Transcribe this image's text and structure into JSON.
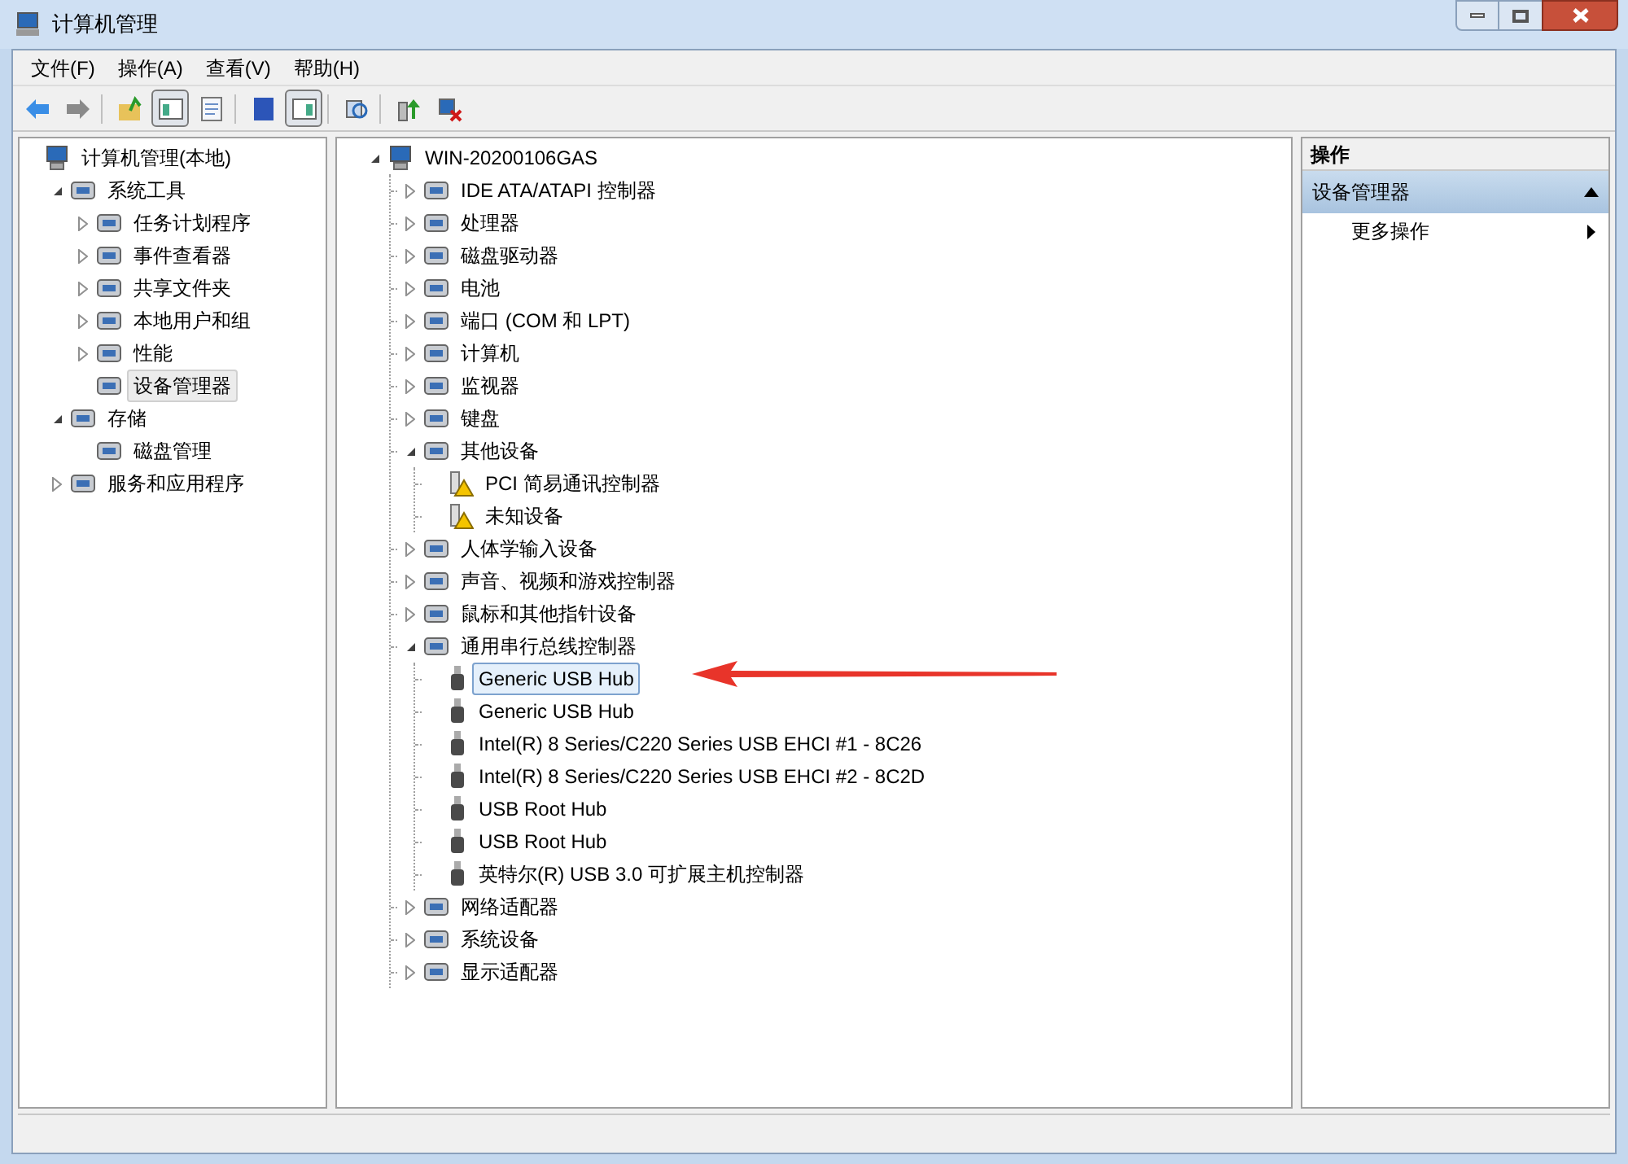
{
  "window": {
    "title": "计算机管理"
  },
  "menu": [
    "文件(F)",
    "操作(A)",
    "查看(V)",
    "帮助(H)"
  ],
  "toolbar": [
    {
      "pressed": false
    },
    {
      "pressed": false
    },
    {
      "pressed": false
    },
    {
      "pressed": true
    },
    {
      "pressed": false
    },
    {
      "pressed": false
    },
    {
      "pressed": true
    },
    {
      "pressed": false
    },
    {
      "pressed": false
    },
    {
      "pressed": false
    }
  ],
  "nav_tree": [
    {
      "label": "计算机管理(本地)",
      "selected": false,
      "children": [
        {
          "label": "系统工具",
          "expanded": true,
          "selected": false,
          "children": [
            {
              "label": "任务计划程序",
              "expanded": false,
              "selected": false
            },
            {
              "label": "事件查看器",
              "expanded": false,
              "selected": false
            },
            {
              "label": "共享文件夹",
              "expanded": false,
              "selected": false
            },
            {
              "label": "本地用户和组",
              "expanded": false,
              "selected": false
            },
            {
              "label": "性能",
              "expanded": false,
              "selected": false
            },
            {
              "label": "设备管理器",
              "selected": true
            }
          ]
        },
        {
          "label": "存储",
          "expanded": true,
          "selected": false,
          "children": [
            {
              "label": "磁盘管理",
              "selected": false
            }
          ]
        },
        {
          "label": "服务和应用程序",
          "expanded": false,
          "selected": false
        }
      ]
    }
  ],
  "device_tree": [
    {
      "label": "WIN-20200106GAS",
      "expanded": true,
      "selected": false,
      "children": [
        {
          "label": "IDE ATA/ATAPI 控制器",
          "expanded": false,
          "selected": false
        },
        {
          "label": "处理器",
          "expanded": false,
          "selected": false
        },
        {
          "label": "磁盘驱动器",
          "expanded": false,
          "selected": false
        },
        {
          "label": "电池",
          "expanded": false,
          "selected": false
        },
        {
          "label": "端口 (COM 和 LPT)",
          "expanded": false,
          "selected": false
        },
        {
          "label": "计算机",
          "expanded": false,
          "selected": false
        },
        {
          "label": "监视器",
          "expanded": false,
          "selected": false
        },
        {
          "label": "键盘",
          "expanded": false,
          "selected": false
        },
        {
          "label": "其他设备",
          "expanded": true,
          "selected": false,
          "children": [
            {
              "label": "PCI 简易通讯控制器",
              "selected": false,
              "warning": true
            },
            {
              "label": "未知设备",
              "selected": false,
              "warning": true
            }
          ]
        },
        {
          "label": "人体学输入设备",
          "expanded": false,
          "selected": false
        },
        {
          "label": "声音、视频和游戏控制器",
          "expanded": false,
          "selected": false
        },
        {
          "label": "鼠标和其他指针设备",
          "expanded": false,
          "selected": false
        },
        {
          "label": "通用串行总线控制器",
          "expanded": true,
          "selected": false,
          "children": [
            {
              "label": "Generic USB Hub",
              "selected": true,
              "warning": false
            },
            {
              "label": "Generic USB Hub",
              "selected": false,
              "warning": false
            },
            {
              "label": "Intel(R) 8 Series/C220 Series USB EHCI #1 - 8C26",
              "selected": false,
              "warning": false
            },
            {
              "label": "Intel(R) 8 Series/C220 Series USB EHCI #2 - 8C2D",
              "selected": false,
              "warning": false
            },
            {
              "label": "USB Root Hub",
              "selected": false,
              "warning": false
            },
            {
              "label": "USB Root Hub",
              "selected": false,
              "warning": false
            },
            {
              "label": "英特尔(R) USB 3.0 可扩展主机控制器",
              "selected": false,
              "warning": false
            }
          ]
        },
        {
          "label": "网络适配器",
          "expanded": false,
          "selected": false
        },
        {
          "label": "系统设备",
          "expanded": false,
          "selected": false
        },
        {
          "label": "显示适配器",
          "expanded": false,
          "selected": false
        }
      ]
    }
  ],
  "actions": {
    "header": "操作",
    "section": {
      "label": "设备管理器",
      "expanded": true
    },
    "items": [
      "更多操作"
    ]
  }
}
